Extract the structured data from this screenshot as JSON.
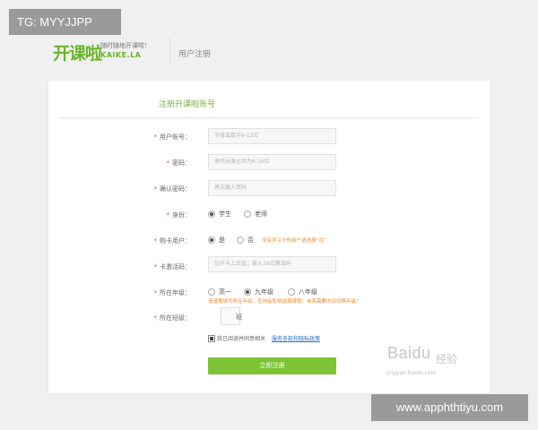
{
  "overlay_tag": "TG: MYYJJPP",
  "header": {
    "logo_cn": "开课啦",
    "slogan": "随时随地开课啦！",
    "logo_en": "KAIKE.LA",
    "title": "用户注册"
  },
  "form": {
    "section_title": "注册开课啦账号",
    "fields": {
      "account": {
        "label": "用户账号：",
        "placeholder": "字母或数字6-12位"
      },
      "password": {
        "label": "密码：",
        "placeholder": "密码长度必须为6-16位"
      },
      "confirm": {
        "label": "确认密码：",
        "placeholder": "再次输入密码"
      },
      "role": {
        "label": "身份：",
        "options": [
          "学生",
          "老师"
        ],
        "selected": "学生"
      },
      "card_user": {
        "label": "购卡用户：",
        "options": [
          "是",
          "否"
        ],
        "selected": "是",
        "note": "没有学习卡的用户请选择“否”"
      },
      "card_code": {
        "label": "卡激活码：",
        "placeholder": "刮开卡上涂层，输入16位激活码"
      },
      "grade": {
        "label": "所在年级：",
        "options": [
          "高一",
          "九年级",
          "八年级"
        ],
        "selected": "九年级",
        "note": "请谨慎填写所在年级，否则会影响选择课程，未来需要中间切换年级！"
      },
      "class": {
        "label": "所在班级：",
        "unit": "班"
      }
    },
    "agree": {
      "text": "我已阅读并同意相关",
      "link": "服务条款和隐私政策"
    },
    "submit_label": "立即注册"
  },
  "watermarks": {
    "baidu": "Baidu",
    "jingyan": "经验",
    "baidu_url": "jingyan.baidu.com",
    "site": "www.apphthtiyu.com"
  }
}
